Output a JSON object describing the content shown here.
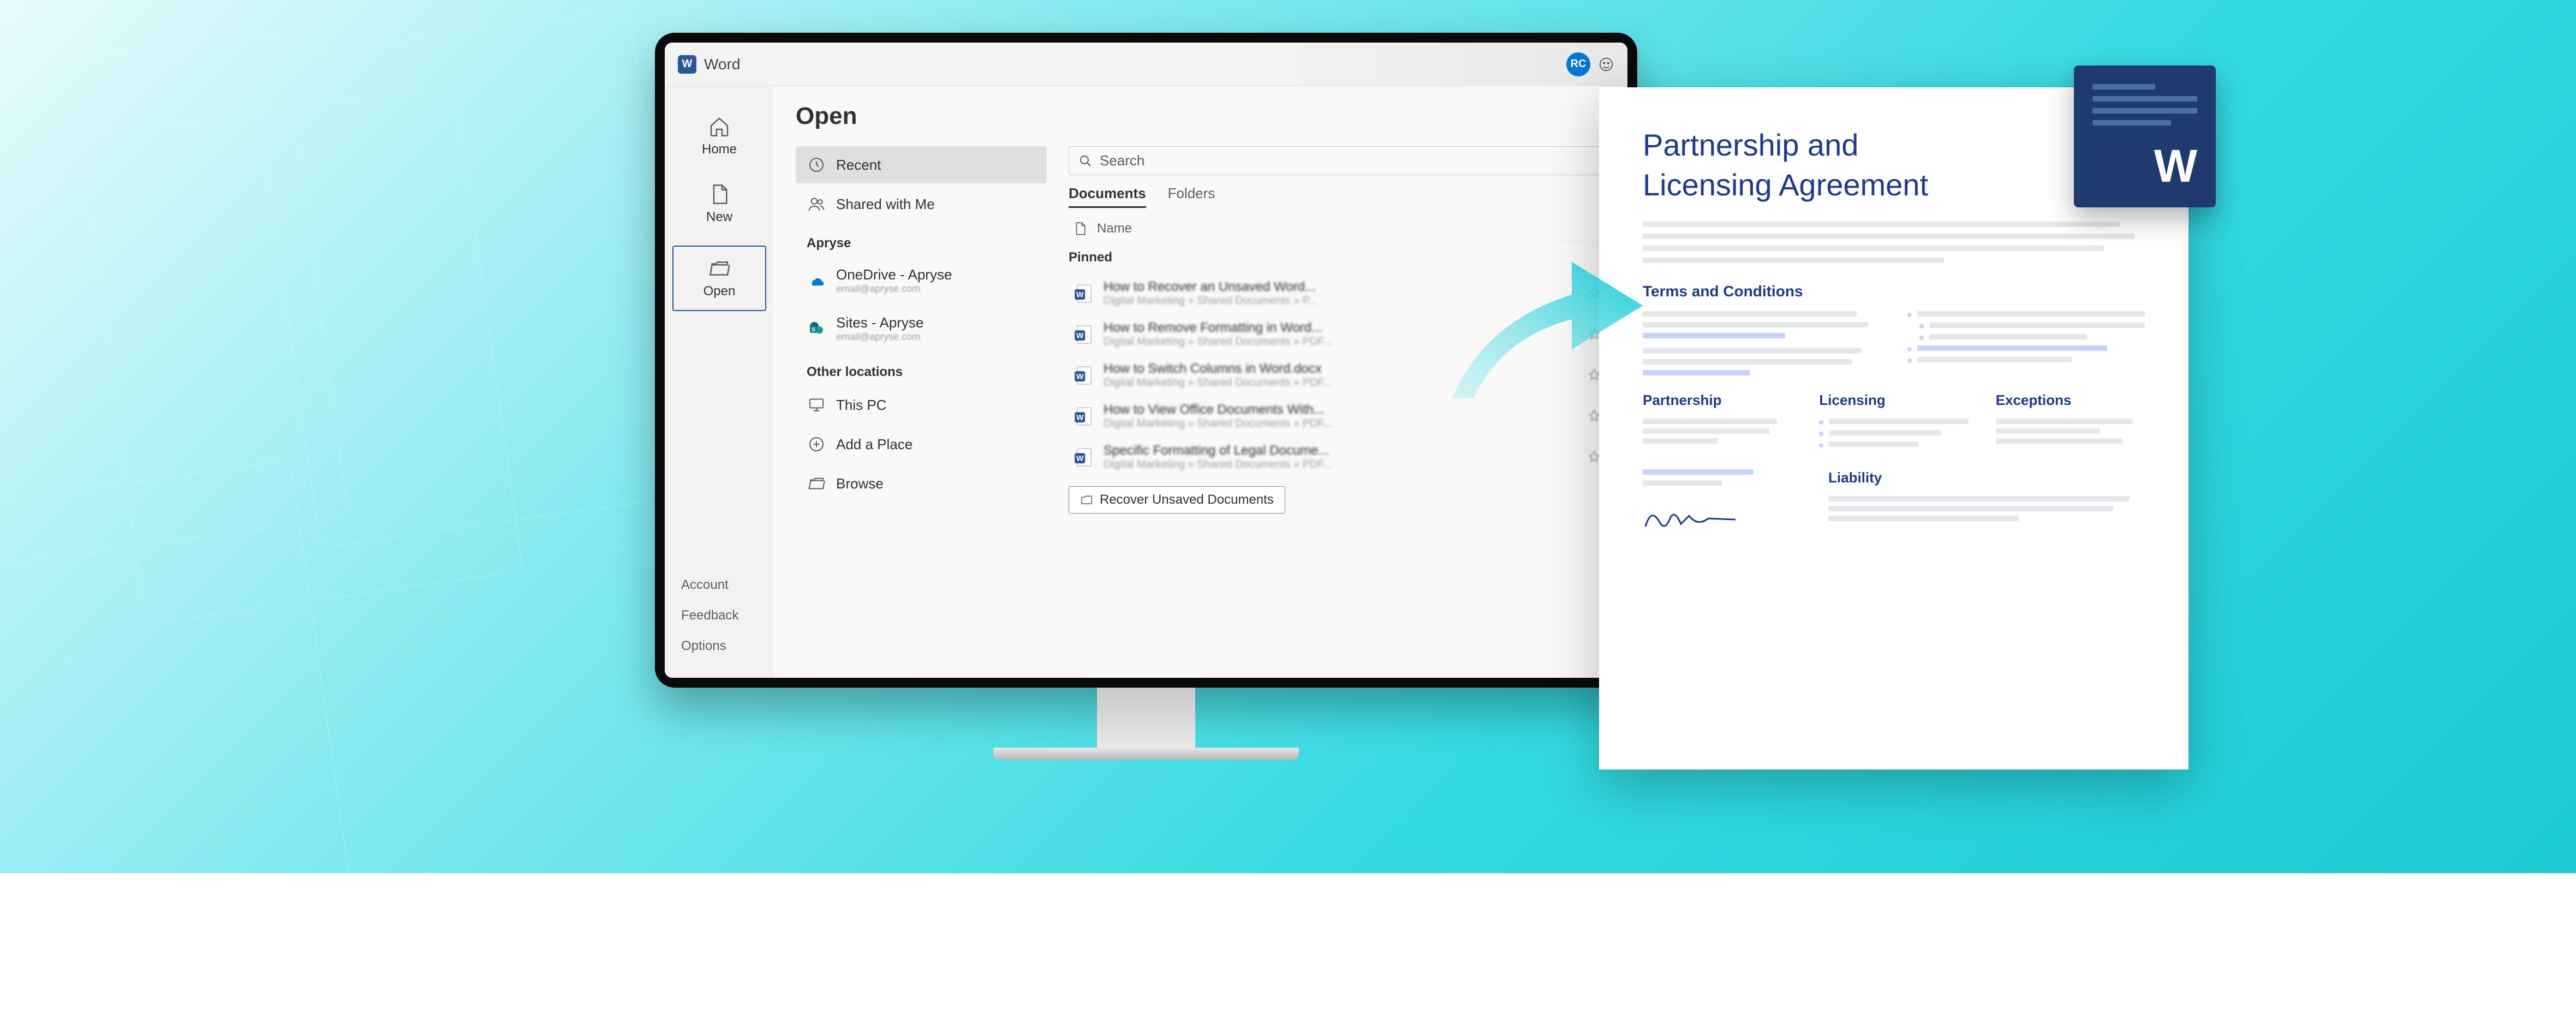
{
  "titlebar": {
    "app": "Word",
    "avatar": "RC"
  },
  "nav": {
    "home": "Home",
    "new": "New",
    "open": "Open",
    "account": "Account",
    "feedback": "Feedback",
    "options": "Options"
  },
  "main": {
    "title": "Open",
    "sources": {
      "recent": "Recent",
      "shared": "Shared with Me",
      "group_apryse": "Apryse",
      "onedrive": "OneDrive - Apryse",
      "onedrive_sub": "email@apryse.com",
      "sites": "Sites - Apryse",
      "sites_sub": "email@apryse.com",
      "group_other": "Other locations",
      "thispc": "This PC",
      "addplace": "Add a Place",
      "browse": "Browse"
    },
    "search_placeholder": "Search",
    "tabs": {
      "documents": "Documents",
      "folders": "Folders"
    },
    "col_name": "Name",
    "group_pinned": "Pinned",
    "files": [
      {
        "name": "How to Recover an Unsaved Word...",
        "path": "Digital Marketing » Shared Documents » P..."
      },
      {
        "name": "How to Remove Formatting in Word...",
        "path": "Digital Marketing » Shared Documents » PDF..."
      },
      {
        "name": "How to Switch Columns in Word.docx",
        "path": "Digital Marketing » Shared Documents » PDF..."
      },
      {
        "name": "How to View Office Documents With...",
        "path": "Digital Marketing » Shared Documents » PDF..."
      },
      {
        "name": "Specific Formatting of Legal Docume...",
        "path": "Digital Marketing » Shared Documents » PDF..."
      }
    ],
    "recover": "Recover Unsaved Documents"
  },
  "doc": {
    "title_l1": "Partnership and",
    "title_l2": "Licensing Agreement",
    "sect_terms": "Terms and Conditions",
    "col_partnership": "Partnership",
    "col_licensing": "Licensing",
    "col_exceptions": "Exceptions",
    "col_liability": "Liability"
  }
}
